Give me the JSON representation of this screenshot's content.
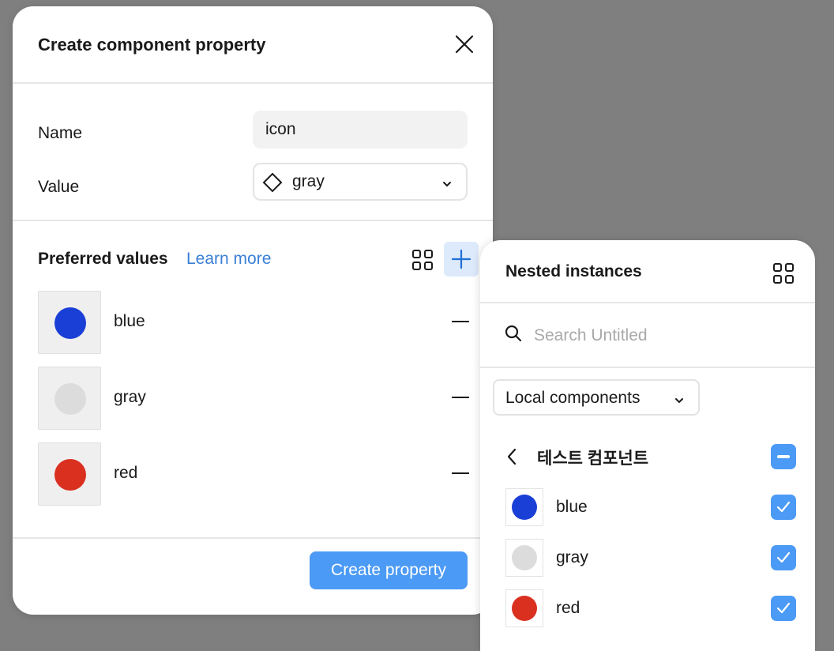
{
  "dialog": {
    "title": "Create component property",
    "name_label": "Name",
    "name_value": "icon",
    "value_label": "Value",
    "value_selected": "gray",
    "preferred_title": "Preferred values",
    "learn_more": "Learn more",
    "preferred_items": [
      {
        "label": "blue",
        "color": "#1a3fd6"
      },
      {
        "label": "gray",
        "color": "#dcdcdc"
      },
      {
        "label": "red",
        "color": "#d93020"
      }
    ],
    "create_button": "Create property",
    "icons": {
      "close": "close-icon",
      "grid": "grid-icon",
      "add": "plus-icon",
      "value": "diamond-icon",
      "dropdown": "chevron-down-icon",
      "remove": "minus-icon"
    }
  },
  "panel": {
    "title": "Nested instances",
    "search_placeholder": "Search Untitled",
    "library_dropdown": "Local components",
    "group_title": "테스트 컴포넌트",
    "items": [
      {
        "label": "blue",
        "color": "#1a3fd6",
        "checked": true
      },
      {
        "label": "gray",
        "color": "#dcdcdc",
        "checked": true
      },
      {
        "label": "red",
        "color": "#d93020",
        "checked": true
      }
    ],
    "icons": {
      "grid": "grid-icon",
      "search": "search-icon",
      "back": "chevron-left-icon",
      "group_state": "indeterminate-checkbox-icon",
      "check": "check-icon"
    }
  },
  "colors": {
    "accent": "#4b9af5",
    "link": "#3a7fd6",
    "backdrop": "#7f7f7f"
  }
}
